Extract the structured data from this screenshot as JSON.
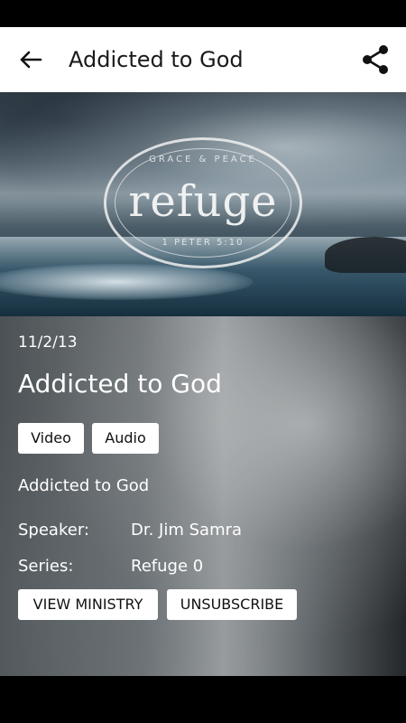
{
  "app_bar": {
    "title": "Addicted to God",
    "back_icon": "arrow-back-icon",
    "share_icon": "share-icon"
  },
  "hero": {
    "seal_top": "GRACE & PEACE",
    "seal_word": "refuge",
    "seal_bottom": "1 PETER 5:10"
  },
  "message": {
    "date": "11/2/13",
    "title": "Addicted to God",
    "media_buttons": [
      "Video",
      "Audio"
    ],
    "description": "Addicted to God",
    "speaker_label": "Speaker:",
    "speaker": "Dr. Jim Samra",
    "series_label": "Series:",
    "series": "Refuge 0"
  },
  "actions": {
    "view_ministry": "VIEW MINISTRY",
    "unsubscribe": "UNSUBSCRIBE"
  }
}
